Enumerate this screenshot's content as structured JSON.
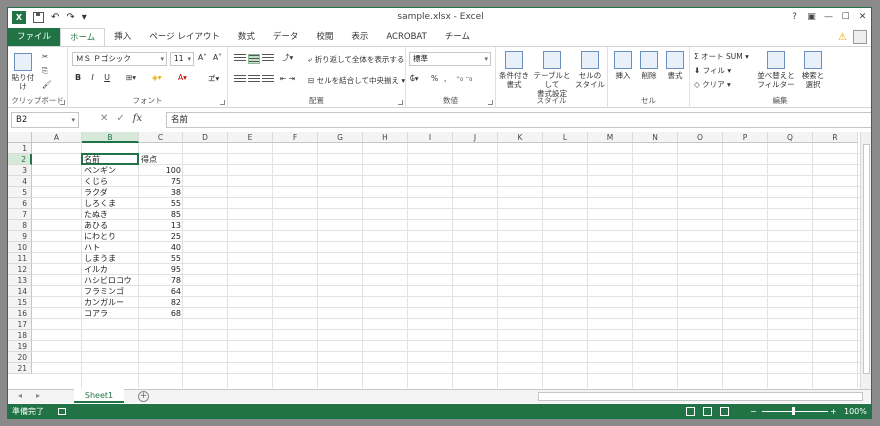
{
  "window": {
    "title": "sample.xlsx - Excel",
    "controls": [
      "?",
      "▣",
      "—",
      "☐",
      "✕"
    ]
  },
  "qat": {
    "app_icon_text": "X",
    "undo": "↶",
    "redo": "↷",
    "more": "▾"
  },
  "tabs": [
    "ファイル",
    "ホーム",
    "挿入",
    "ページ レイアウト",
    "数式",
    "データ",
    "校閲",
    "表示",
    "ACROBAT",
    "チーム"
  ],
  "account": {
    "warning": "⚠"
  },
  "ribbon": {
    "clipboard": {
      "label": "クリップボード",
      "paste": "貼り付け"
    },
    "font": {
      "label": "フォント",
      "name": "ＭＳ Ｐゴシック",
      "size": "11",
      "grow": "A˄",
      "shrink": "A˅",
      "bold": "B",
      "italic": "I",
      "underline": "U"
    },
    "alignment": {
      "label": "配置",
      "wrap": "折り返して全体を表示する",
      "merge": "セルを結合して中央揃え"
    },
    "number": {
      "label": "数値",
      "format": "標準",
      "currency": "₲",
      "percent": "%",
      "comma": ","
    },
    "styles": {
      "label": "スタイル",
      "conditional": [
        "条件付き",
        "書式"
      ],
      "table": [
        "テーブルとして",
        "書式設定"
      ],
      "cell": [
        "セルの",
        "スタイル"
      ]
    },
    "cells": {
      "label": "セル",
      "insert": "挿入",
      "delete": "削除",
      "format": "書式"
    },
    "editing": {
      "label": "編集",
      "autosum": "Σ オート SUM",
      "fill": "フィル",
      "clear": "クリア",
      "sort": [
        "並べ替えと",
        "フィルター"
      ],
      "find": [
        "検索と",
        "選択"
      ]
    }
  },
  "formula_bar": {
    "name_box": "B2",
    "cancel": "✕",
    "enter": "✓",
    "fx": "fx",
    "content": "名前"
  },
  "columns": [
    "A",
    "B",
    "C",
    "D",
    "E",
    "F",
    "G",
    "H",
    "I",
    "J",
    "K",
    "L",
    "M",
    "N",
    "O",
    "P",
    "Q",
    "R"
  ],
  "rows": [
    "1",
    "2",
    "3",
    "4",
    "5",
    "6",
    "7",
    "8",
    "9",
    "10",
    "11",
    "12",
    "13",
    "14",
    "15",
    "16",
    "17",
    "18",
    "19",
    "20",
    "21"
  ],
  "table": {
    "header": [
      "名前",
      "得点"
    ],
    "rows": [
      [
        "ペンギン",
        "100"
      ],
      [
        "くじら",
        "75"
      ],
      [
        "ラクダ",
        "38"
      ],
      [
        "しろくま",
        "55"
      ],
      [
        "たぬき",
        "85"
      ],
      [
        "あひる",
        "13"
      ],
      [
        "にわとり",
        "25"
      ],
      [
        "ハト",
        "40"
      ],
      [
        "しまうま",
        "55"
      ],
      [
        "イルカ",
        "95"
      ],
      [
        "ハシビロコウ",
        "78"
      ],
      [
        "フラミンゴ",
        "64"
      ],
      [
        "カンガルー",
        "82"
      ],
      [
        "コアラ",
        "68"
      ]
    ]
  },
  "sheets": [
    "Sheet1"
  ],
  "sheet_nav": [
    "◂",
    "▸"
  ],
  "status": {
    "ready": "準備完了",
    "zoom_minus": "−",
    "zoom_plus": "+",
    "zoom": "100%"
  }
}
